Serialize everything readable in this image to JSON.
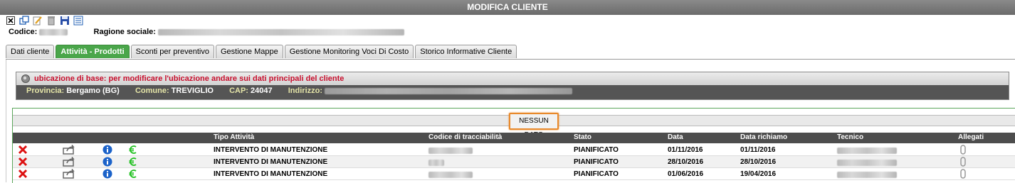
{
  "window": {
    "title": "MODIFICA CLIENTE"
  },
  "toolbar": {
    "icons": [
      "close-icon",
      "copy-icon",
      "edit-icon",
      "delete-icon",
      "save-icon",
      "list-icon"
    ]
  },
  "client": {
    "code_label": "Codice:",
    "ragione_label": "Ragione sociale:"
  },
  "tabs": [
    {
      "label": "Dati cliente",
      "active": false
    },
    {
      "label": "Attività - Prodotti",
      "active": true
    },
    {
      "label": "Sconti per preventivo",
      "active": false
    },
    {
      "label": "Gestione Mappe",
      "active": false
    },
    {
      "label": "Gestione Monitoring Voci Di Costo",
      "active": false
    },
    {
      "label": "Storico Informative Cliente",
      "active": false
    }
  ],
  "ubicazione": {
    "message": "ubicazione di base: per modificare l'ubicazione andare sui dati principali del cliente",
    "provincia_label": "Provincia:",
    "provincia_value": "Bergamo (BG)",
    "comune_label": "Comune:",
    "comune_value": "TREVIGLIO",
    "cap_label": "CAP:",
    "cap_value": "24047",
    "indirizzo_label": "Indirizzo:"
  },
  "grid": {
    "no_data_label": "NESSUN DATO",
    "columns": [
      "Tipo Attività",
      "Codice di tracciabilità",
      "Stato",
      "Data",
      "Data richiamo",
      "Tecnico",
      "Allegati"
    ],
    "rows": [
      {
        "tipo": "INTERVENTO DI MANUTENZIONE",
        "stato": "PIANIFICATO",
        "data": "01/11/2016",
        "data_richiamo": "01/11/2016"
      },
      {
        "tipo": "INTERVENTO DI MANUTENZIONE",
        "stato": "PIANIFICATO",
        "data": "28/10/2016",
        "data_richiamo": "28/10/2016"
      },
      {
        "tipo": "INTERVENTO DI MANUTENZIONE",
        "stato": "PIANIFICATO",
        "data": "01/06/2016",
        "data_richiamo": "19/04/2016"
      }
    ]
  },
  "colors": {
    "accent_tab": "#4aa64a",
    "highlight": "#e8892b",
    "error_text": "#c8102e"
  }
}
